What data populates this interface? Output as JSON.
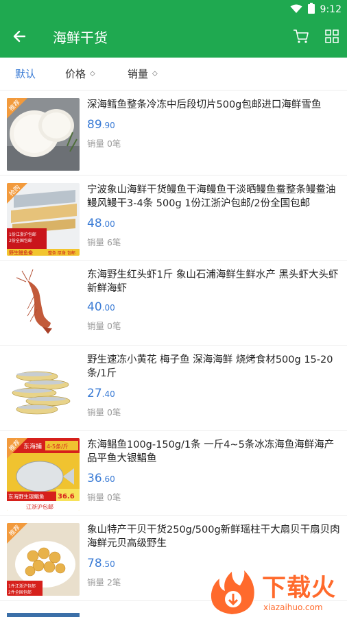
{
  "status": {
    "time": "9:12"
  },
  "header": {
    "title": "海鲜干货"
  },
  "sort": [
    {
      "label": "默认",
      "arrow": ""
    },
    {
      "label": "价格",
      "arrow": "◇"
    },
    {
      "label": "销量",
      "arrow": "◇"
    }
  ],
  "products": [
    {
      "name": "深海鳕鱼整条冷冻中后段切片500g包邮进口海鲜雪鱼",
      "price_int": "89",
      "price_dec": ".90",
      "sales": "销量 0笔",
      "badge": "推荐"
    },
    {
      "name": "宁波象山海鲜干货鳗鱼干海鳗鱼干淡晒鳗鱼鲞整条鳗鲞油鳗风鳗干3-4条 500g 1份江浙沪包邮/2份全国包邮",
      "price_int": "48",
      "price_dec": ".00",
      "sales": "销量 6笔",
      "badge": "抢购",
      "img_text1": "1份江浙沪包邮",
      "img_text2": "2份全国包邮",
      "img_text3": "整条 厚身 包邮",
      "img_text4": "野生鳗鱼鲞"
    },
    {
      "name": "东海野生红头虾1斤 象山石浦海鲜生鲜水产 黑头虾大头虾 新鲜海虾",
      "price_int": "40",
      "price_dec": ".00",
      "sales": "销量 0笔"
    },
    {
      "name": "野生速冻小黄花 梅子鱼 深海海鲜 烧烤食材500g 15-20条/1斤",
      "price_int": "27",
      "price_dec": ".40",
      "sales": "销量 0笔"
    },
    {
      "name": "东海鲳鱼100g-150g/1条 一斤4~5条冰冻海鱼海鲜海产品平鱼大银鲳鱼",
      "price_int": "36",
      "price_dec": ".60",
      "sales": "销量 0笔",
      "badge": "推荐",
      "img_text1": "东海捕",
      "img_text2": "4-5条/斤",
      "img_text3": "东海野生银鲳鱼",
      "img_text4": "江浙沪包邮",
      "img_price": "36.6"
    },
    {
      "name": "象山特产干贝干货250g/500g新鲜瑶柱干大扇贝干扇贝肉海鲜元贝高级野生",
      "price_int": "78",
      "price_dec": ".50",
      "sales": "销量 2笔",
      "badge": "推荐",
      "img_text1": "1件江浙沪包邮",
      "img_text2": "2件全国包邮"
    }
  ],
  "watermark": {
    "brand": "下载火",
    "url": "xiazaihuo.com"
  },
  "colors": {
    "primary": "#1fa950",
    "price": "#3a7bd5",
    "active_sort": "#3a7bd5"
  }
}
